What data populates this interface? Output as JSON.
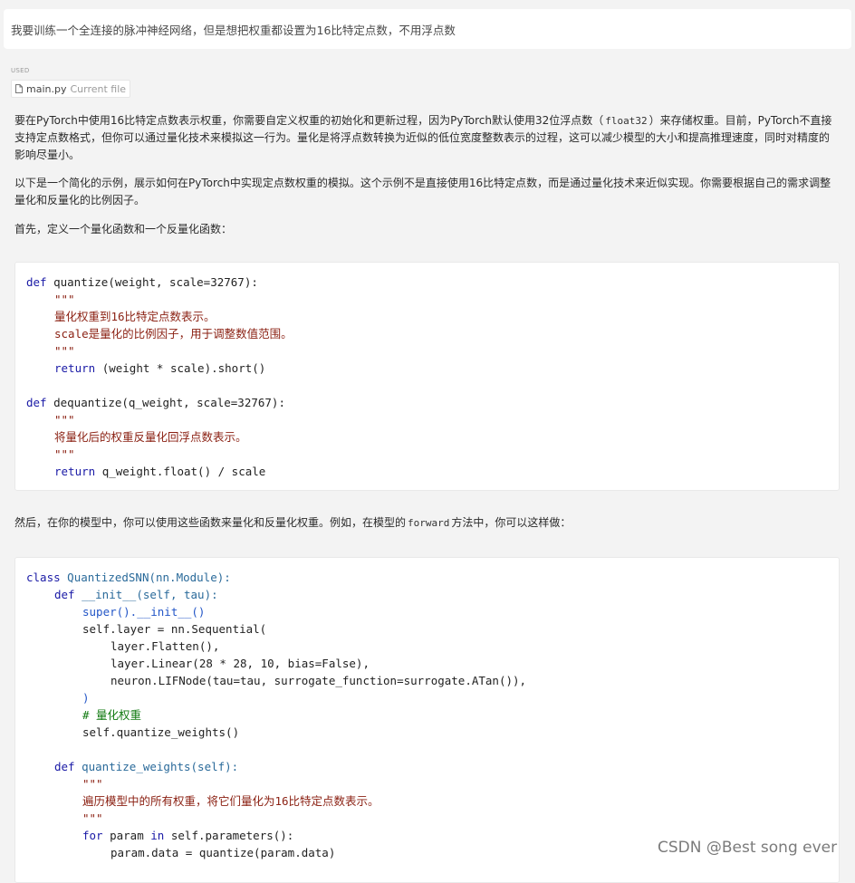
{
  "user_message": "我要训练一个全连接的脉冲神经网络，但是想把权重都设置为16比特定点数，不用浮点数",
  "used": {
    "label": "USED",
    "file_name": "main.py",
    "file_note": "Current file"
  },
  "answer": {
    "p1_a": "要在PyTorch中使用16比特定点数表示权重，你需要自定义权重的初始化和更新过程，因为PyTorch默认使用32位浮点数（",
    "p1_code": "float32",
    "p1_b": "）来存储权重。目前，PyTorch不直接支持定点数格式，但你可以通过量化技术来模拟这一行为。量化是将浮点数转换为近似的低位宽度整数表示的过程，这可以减少模型的大小和提高推理速度，同时对精度的影响尽量小。",
    "p2": "以下是一个简化的示例，展示如何在PyTorch中实现定点数权重的模拟。这个示例不是直接使用16比特定点数，而是通过量化技术来近似实现。你需要根据自己的需求调整量化和反量化的比例因子。",
    "p3": "首先，定义一个量化函数和一个反量化函数：",
    "p4_a": "然后，在你的模型中，你可以使用这些函数来量化和反量化权重。例如，在模型的",
    "p4_code": "forward",
    "p4_b": "方法中，你可以这样做："
  },
  "code1": {
    "l1": "quantize(weight, scale=32767):",
    "l2": "\"\"\"",
    "l3": "量化权重到16比特定点数表示。",
    "l4": "scale是量化的比例因子，用于调整数值范围。",
    "l5": "\"\"\"",
    "l6": "(weight * scale).short()",
    "l7": "dequantize(q_weight, scale=32767):",
    "l8": "\"\"\"",
    "l9": "将量化后的权重反量化回浮点数表示。",
    "l10": "\"\"\"",
    "l11": "q_weight.float() / scale"
  },
  "code2": {
    "l1": "QuantizedSNN(nn.Module):",
    "l2": "__init__(self, tau):",
    "l3": "super().__init__()",
    "l4": "self.layer = nn.Sequential(",
    "l5": "layer.Flatten(),",
    "l6": "layer.Linear(28 * 28, 10, bias=False),",
    "l7": "neuron.LIFNode(tau=tau, surrogate_function=surrogate.ATan()),",
    "l8": ")",
    "l9": "# 量化权重",
    "l10": "self.quantize_weights()",
    "l11": "quantize_weights(self):",
    "l12": "\"\"\"",
    "l13": "遍历模型中的所有权重，将它们量化为16比特定点数表示。",
    "l14": "\"\"\"",
    "l15a": "param",
    "l15b": "self.parameters():",
    "l16": "param.data = quantize(param.data)"
  },
  "keywords": {
    "def": "def",
    "return": "return",
    "class": "class",
    "for": "for",
    "in": "in"
  },
  "watermark": "CSDN @Best song ever"
}
